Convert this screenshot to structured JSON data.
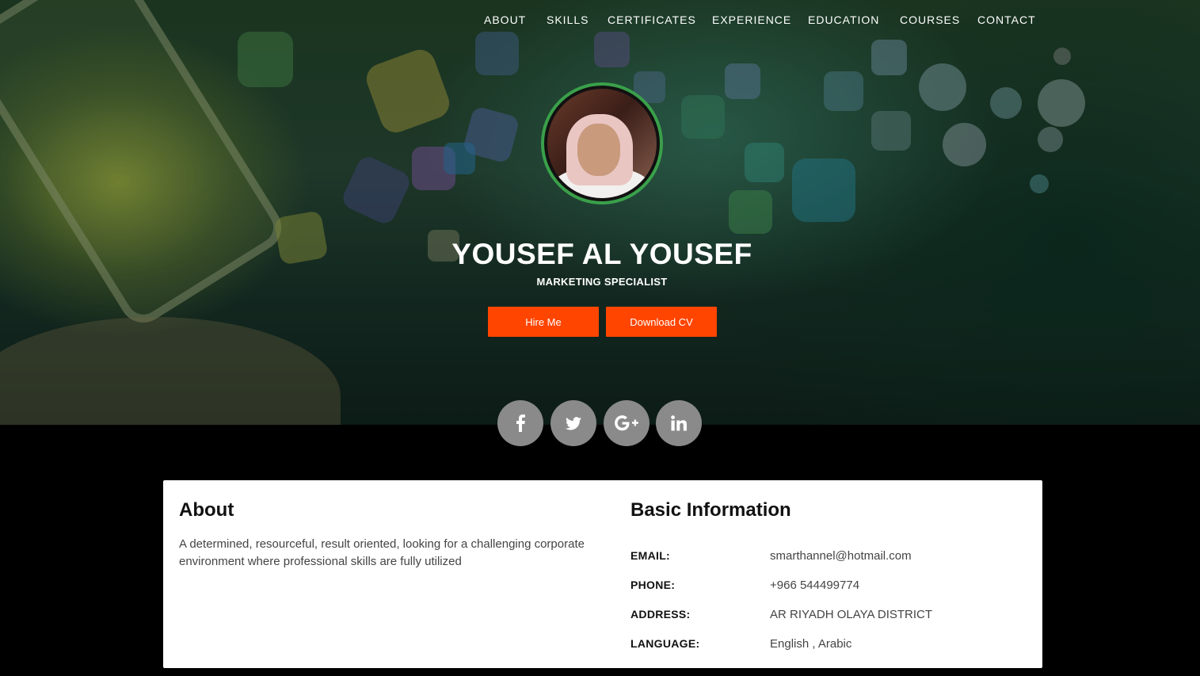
{
  "nav": {
    "items": [
      "ABOUT",
      "SKILLS",
      "CERTIFICATES",
      "EXPERIENCE",
      "EDUCATION",
      "COURSES",
      "CONTACT"
    ]
  },
  "profile": {
    "name": "YOUSEF AL YOUSEF",
    "title": "MARKETING SPECIALIST",
    "hire_label": "Hire Me",
    "cv_label": "Download CV"
  },
  "social": {
    "icons": [
      "facebook-icon",
      "twitter-icon",
      "google-plus-icon",
      "linkedin-icon"
    ]
  },
  "about": {
    "heading": "About",
    "text": "A determined, resourceful, result oriented, looking for a challenging corporate environment where professional skills are fully utilized"
  },
  "basic_info": {
    "heading": "Basic Information",
    "rows": [
      {
        "label": "EMAIL:",
        "value": "smarthannel@hotmail.com"
      },
      {
        "label": "PHONE:",
        "value": "+966 544499774"
      },
      {
        "label": "ADDRESS:",
        "value": "AR RIYADH OLAYA DISTRICT"
      },
      {
        "label": "LANGUAGE:",
        "value": "English , Arabic"
      }
    ]
  },
  "colors": {
    "accent": "#ff4500",
    "avatar_ring": "#3aa04a",
    "social_bg": "#8a8a8a"
  }
}
